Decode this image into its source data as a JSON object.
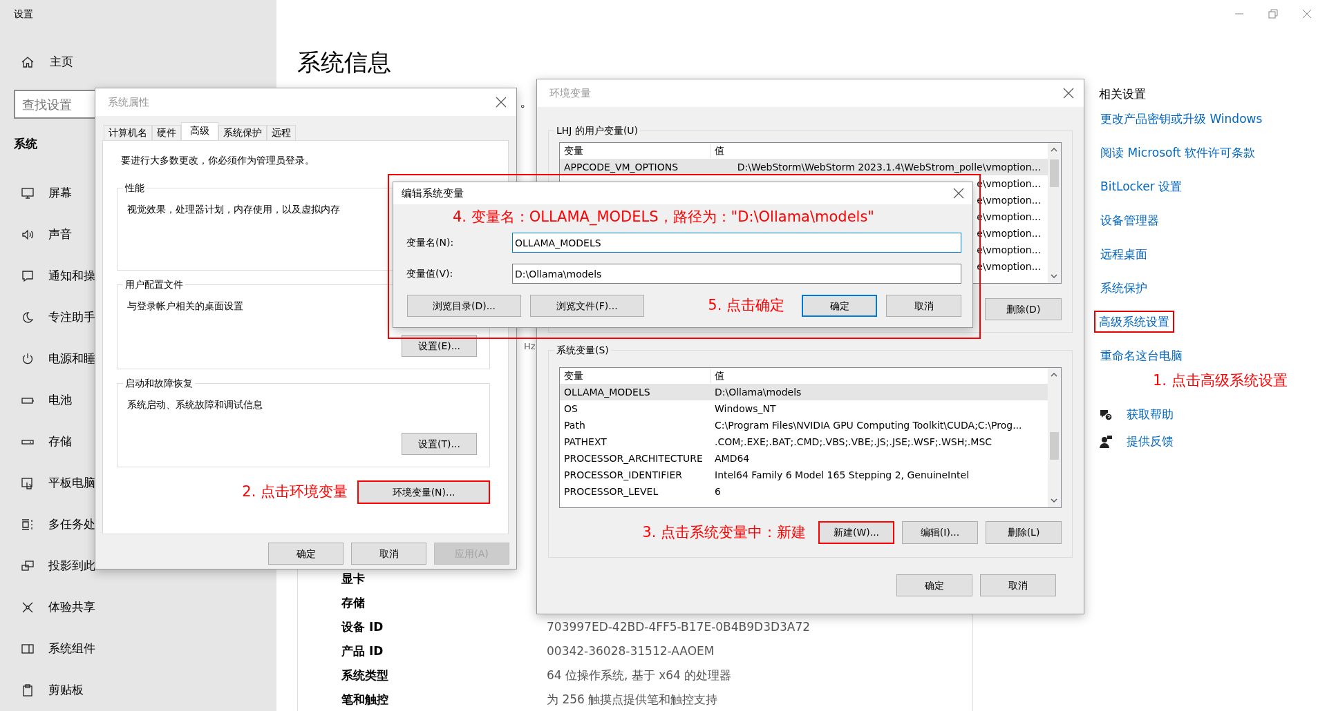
{
  "window": {
    "title": "设置"
  },
  "sidebar": {
    "home": "主页",
    "search": {
      "placeholder": "查找设置"
    },
    "section": "系统",
    "items": [
      {
        "label": "屏幕"
      },
      {
        "label": "声音"
      },
      {
        "label": "通知和操"
      },
      {
        "label": "专注助手"
      },
      {
        "label": "电源和睡"
      },
      {
        "label": "电池"
      },
      {
        "label": "存储"
      },
      {
        "label": "平板电脑"
      },
      {
        "label": "多任务处"
      },
      {
        "label": "投影到此"
      },
      {
        "label": "体验共享"
      },
      {
        "label": "系统组件"
      },
      {
        "label": "剪贴板"
      }
    ]
  },
  "page": {
    "title": "系统信息",
    "partial_text": "。",
    "partial_unit": "Hz",
    "specs": [
      {
        "label": "显卡"
      },
      {
        "label": "存储"
      },
      {
        "label": "设备 ID",
        "value": "703997ED-42BD-4FF5-B17E-0B4B9D3D3A72"
      },
      {
        "label": "产品 ID",
        "value": "00342-36028-31512-AAOEM"
      },
      {
        "label": "系统类型",
        "value": "64 位操作系统, 基于 x64 的处理器"
      },
      {
        "label": "笔和触控",
        "value": "为 256 触摸点提供笔和触控支持"
      }
    ]
  },
  "related": {
    "title": "相关设置",
    "links": [
      {
        "label": "更改产品密钥或升级 Windows",
        "highlighted": false
      },
      {
        "label": "阅读 Microsoft 软件许可条款",
        "highlighted": false
      },
      {
        "label": "BitLocker 设置",
        "highlighted": false
      },
      {
        "label": "设备管理器",
        "highlighted": false
      },
      {
        "label": "远程桌面",
        "highlighted": false
      },
      {
        "label": "系统保护",
        "highlighted": false
      },
      {
        "label": "高级系统设置",
        "highlighted": true
      },
      {
        "label": "重命名这台电脑",
        "highlighted": false
      }
    ],
    "annotation": "1. 点击高级系统设置",
    "help": [
      {
        "label": "获取帮助"
      },
      {
        "label": "提供反馈"
      }
    ]
  },
  "system_properties": {
    "title": "系统属性",
    "tabs": [
      {
        "label": "计算机名",
        "selected": false
      },
      {
        "label": "硬件",
        "selected": false
      },
      {
        "label": "高级",
        "selected": true
      },
      {
        "label": "系统保护",
        "selected": false
      },
      {
        "label": "远程",
        "selected": false
      }
    ],
    "notice": "要进行大多数更改，你必须作为管理员登录。",
    "groups": [
      {
        "title": "性能",
        "text": "视觉效果，处理器计划，内存使用，以及虚拟内存"
      },
      {
        "title": "用户配置文件",
        "text": "与登录帐户相关的桌面设置",
        "button": "设置(E)..."
      },
      {
        "title": "启动和故障恢复",
        "text": "系统启动、系统故障和调试信息",
        "button": "设置(T)..."
      }
    ],
    "annotation": "2. 点击环境变量",
    "env_button": {
      "label": "环境变量(N)...",
      "highlighted": true
    },
    "buttons": [
      {
        "label": "确定",
        "disabled": false
      },
      {
        "label": "取消",
        "disabled": false
      },
      {
        "label": "应用(A)",
        "disabled": true
      }
    ]
  },
  "environment_variables": {
    "title": "环境变量",
    "user_vars": {
      "title": "LHJ 的用户变量(U)",
      "columns": [
        "变量",
        "值"
      ],
      "rows": [
        {
          "name": "APPCODE_VM_OPTIONS",
          "value": "D:\\WebStorm\\WebStorm 2023.1.4\\WebStrom_polle\\vmoption...",
          "selected": true
        },
        {
          "value": "e\\vmoption...",
          "selected": false
        },
        {
          "value": "e\\vmoption...",
          "selected": false
        },
        {
          "value": "e\\vmoption...",
          "selected": false
        },
        {
          "value": "e\\vmoption...",
          "selected": false
        },
        {
          "value": "e\\vmoption...",
          "selected": false
        },
        {
          "value": "e\\vmoption...",
          "selected": false
        }
      ],
      "buttons": [
        {
          "label": "删除(D)",
          "highlighted": false
        }
      ]
    },
    "system_vars": {
      "title": "系统变量(S)",
      "columns": [
        "变量",
        "值"
      ],
      "rows": [
        {
          "name": "OLLAMA_MODELS",
          "value": "D:\\Ollama\\models",
          "selected": true
        },
        {
          "name": "OS",
          "value": "Windows_NT",
          "selected": false
        },
        {
          "name": "Path",
          "value": "C:\\Program Files\\NVIDIA GPU Computing Toolkit\\CUDA;C:\\Prog...",
          "selected": false
        },
        {
          "name": "PATHEXT",
          "value": ".COM;.EXE;.BAT;.CMD;.VBS;.VBE;.JS;.JSE;.WSF;.WSH;.MSC",
          "selected": false
        },
        {
          "name": "PROCESSOR_ARCHITECTURE",
          "value": "AMD64",
          "selected": false
        },
        {
          "name": "PROCESSOR_IDENTIFIER",
          "value": "Intel64 Family 6 Model 165 Stepping 2, GenuineIntel",
          "selected": false
        },
        {
          "name": "PROCESSOR_LEVEL",
          "value": "6",
          "selected": false
        }
      ],
      "annotation": "3. 点击系统变量中：新建",
      "buttons": [
        {
          "label": "新建(W)...",
          "highlighted": true
        },
        {
          "label": "编辑(I)...",
          "highlighted": false
        },
        {
          "label": "删除(L)",
          "highlighted": false
        }
      ]
    },
    "buttons": [
      "确定",
      "取消"
    ]
  },
  "edit_dialog": {
    "title": "编辑系统变量",
    "annotation": "4. 变量名：OLLAMA_MODELS，路径为：\"D:\\Ollama\\models\"",
    "fields": [
      {
        "label": "变量名(N):",
        "value": "OLLAMA_MODELS",
        "focused": true
      },
      {
        "label": "变量值(V):",
        "value": "D:\\Ollama\\models",
        "focused": false
      }
    ],
    "browse_buttons": [
      "浏览目录(D)...",
      "浏览文件(F)..."
    ],
    "step_note": "5. 点击确定",
    "buttons": [
      {
        "label": "确定",
        "default": true
      },
      {
        "label": "取消",
        "default": false
      }
    ]
  }
}
